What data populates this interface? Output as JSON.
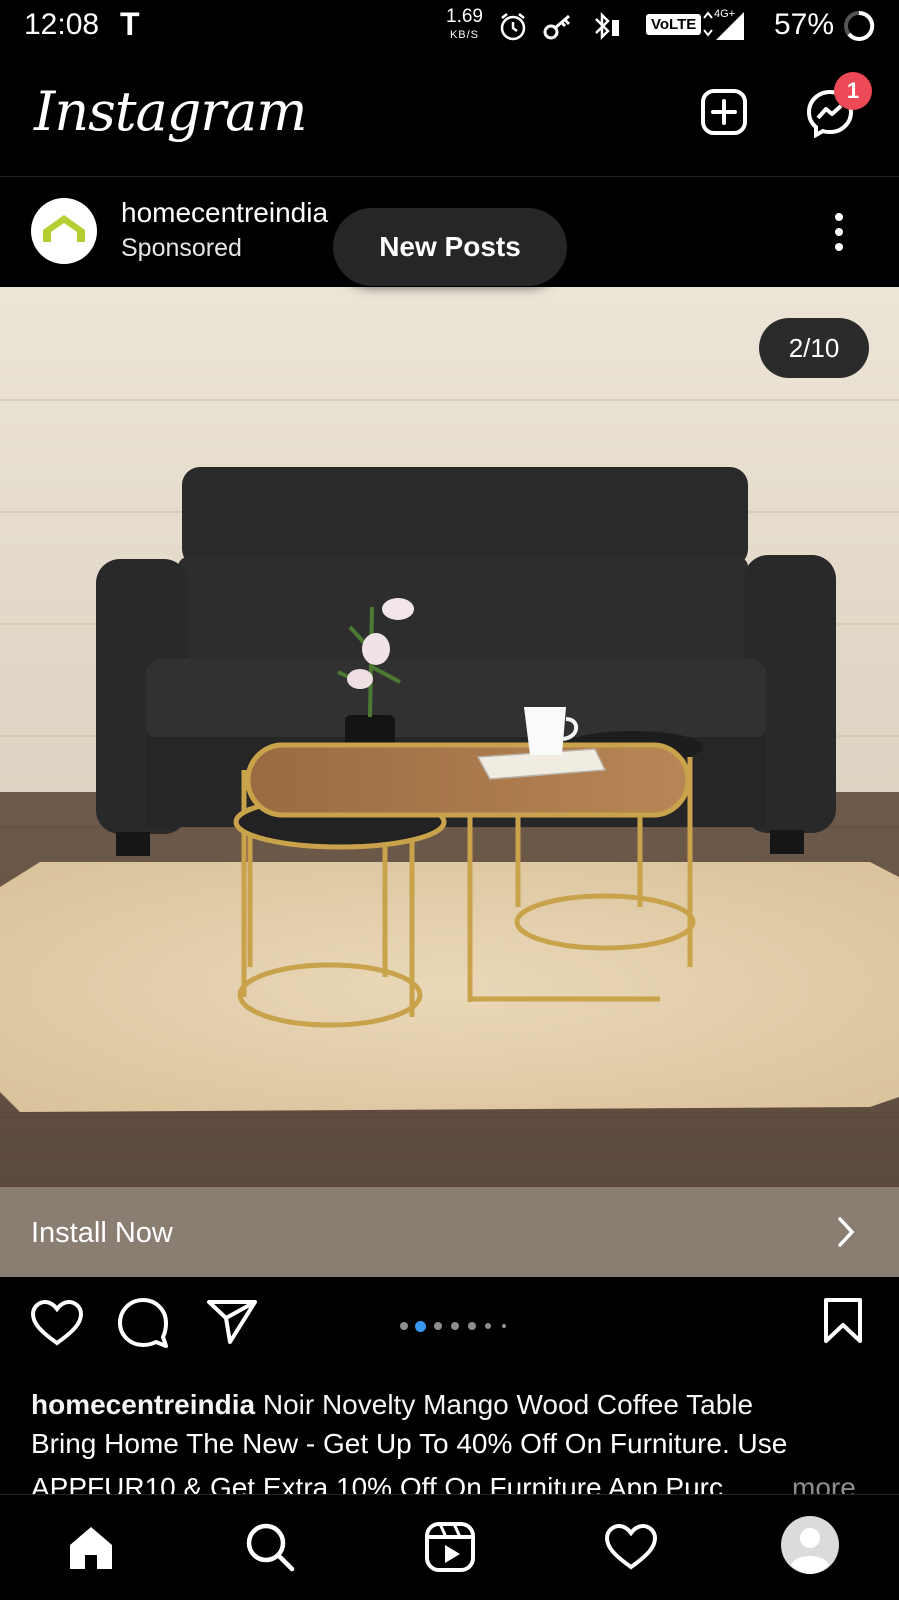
{
  "status_bar": {
    "time": "12:08",
    "notif_glyph": "T",
    "speed_value": "1.69",
    "speed_unit": "KB/S",
    "volte": "VoLTE",
    "network": "4G+",
    "battery": "57%",
    "icons": [
      "alarm-icon",
      "key-icon",
      "bluetooth-icon",
      "signal-icon",
      "battery-icon"
    ]
  },
  "header": {
    "logo": "Instagram",
    "messages_badge": "1"
  },
  "post": {
    "username": "homecentreindia",
    "sponsored_label": "Sponsored",
    "new_posts_label": "New Posts",
    "photo_counter": "2/10",
    "install_label": "Install Now",
    "carousel_active_index": 1,
    "carousel_dot_count": 7,
    "caption_user": "homecentreindia",
    "caption_title": "Noir Novelty Mango Wood Coffee Table",
    "caption_line2": "Bring Home The New - Get Up To 40% Off On Furniture. Use",
    "caption_line3": "APPFUR10 & Get Extra 10% Off On Furniture App Purc...",
    "more_label": "more"
  },
  "bottom_nav": {
    "items": [
      "home-icon",
      "search-icon",
      "reels-icon",
      "activity-heart-icon",
      "profile-avatar"
    ]
  },
  "colors": {
    "background": "#000000",
    "badge": "#ed4956",
    "install_bar": "#8a7d72",
    "dot_active": "#3897f0",
    "dot_inactive": "#8e8e8e"
  }
}
